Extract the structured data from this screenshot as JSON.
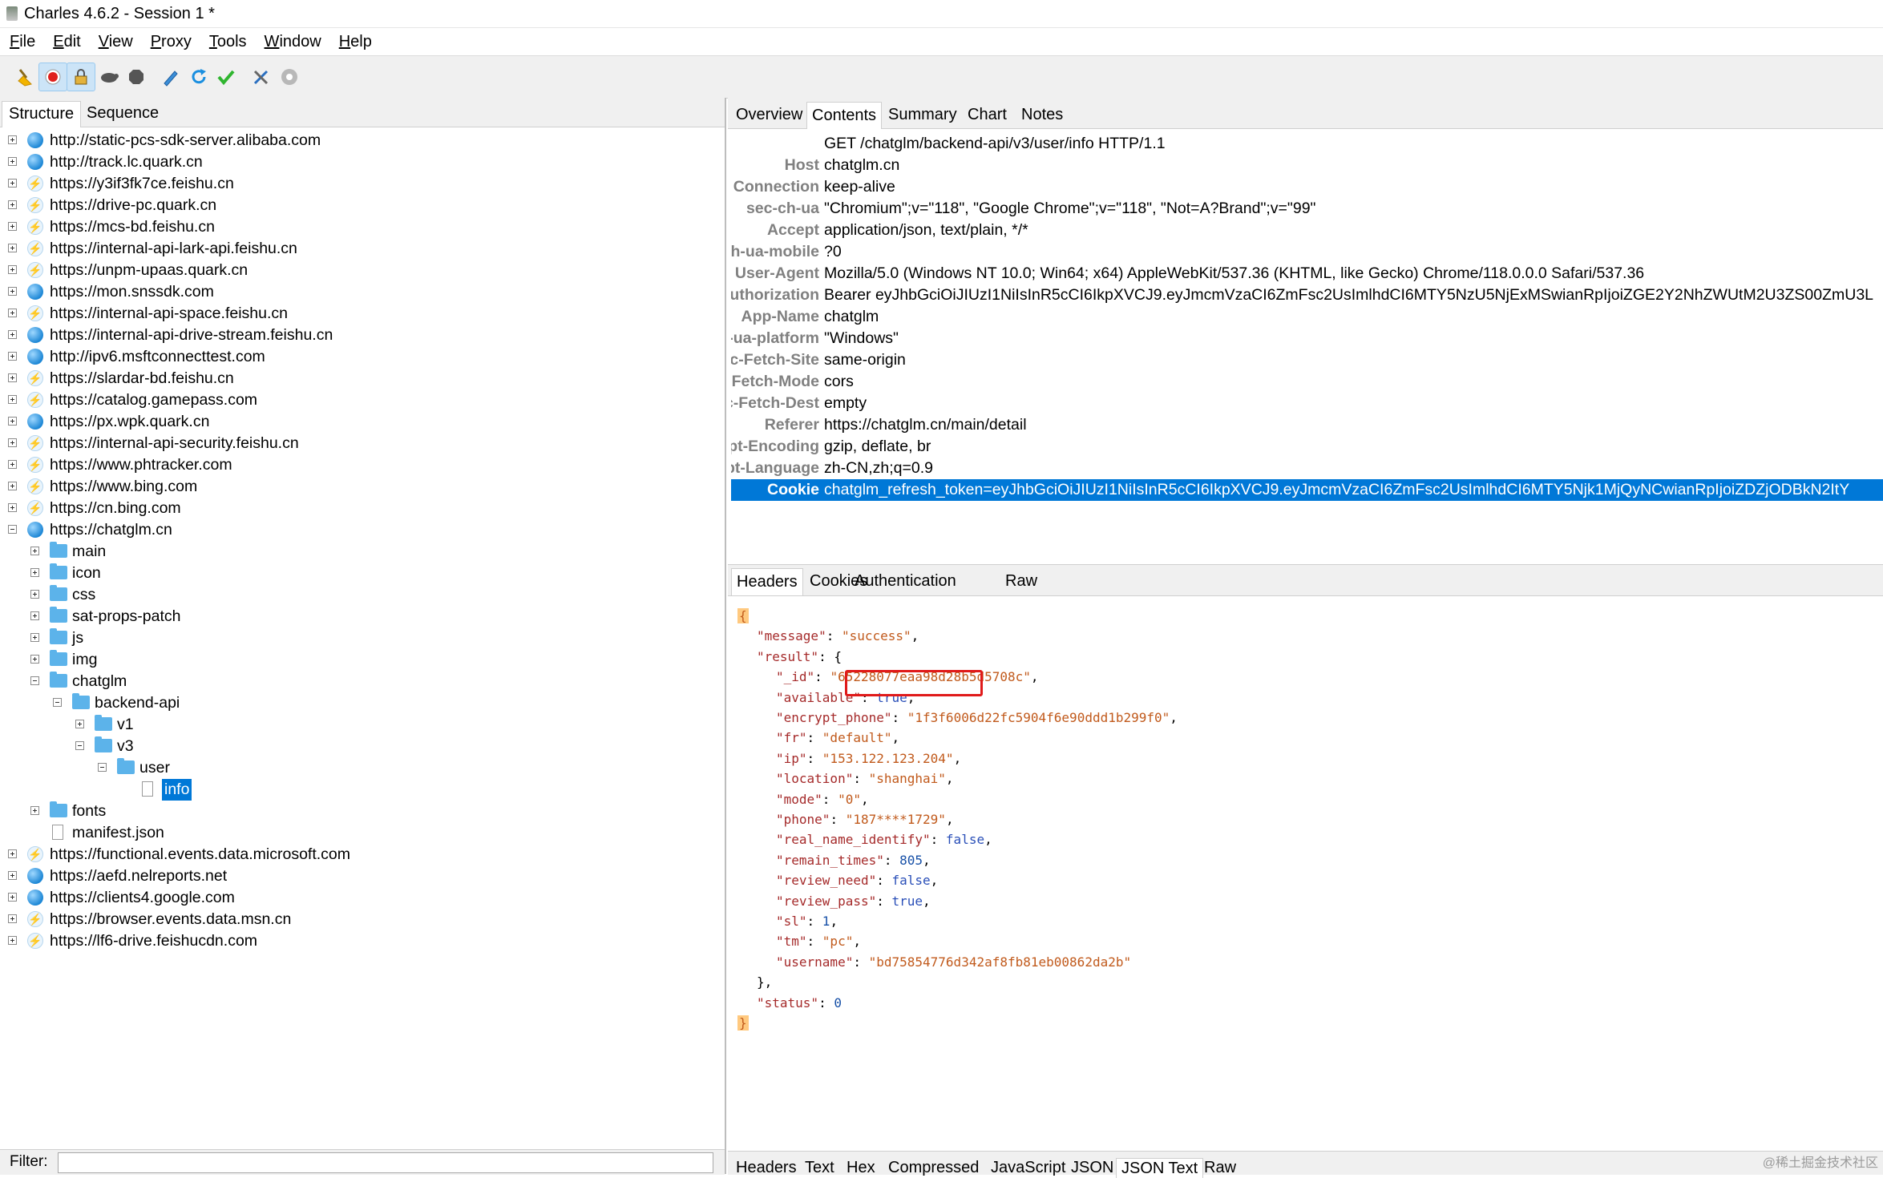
{
  "window": {
    "title": "Charles 4.6.2 - Session 1 *"
  },
  "menu": [
    "File",
    "Edit",
    "View",
    "Proxy",
    "Tools",
    "Window",
    "Help"
  ],
  "toolbar": {
    "buttons": [
      "broom-icon",
      "record-icon",
      "ssl-proxying-icon",
      "throttle-icon",
      "breakpoints-icon",
      "compose-icon",
      "repeat-icon",
      "validate-icon",
      "tools-icon",
      "settings-icon"
    ]
  },
  "left": {
    "tabs": [
      "Structure",
      "Sequence"
    ],
    "tree": [
      {
        "label": "http://static-pcs-sdk-server.alibaba.com",
        "icon": "globe",
        "depth": 0,
        "exp": "plus"
      },
      {
        "label": "http://track.lc.quark.cn",
        "icon": "globe",
        "depth": 0,
        "exp": "plus"
      },
      {
        "label": "https://y3if3fk7ce.feishu.cn",
        "icon": "bolt",
        "depth": 0,
        "exp": "plus"
      },
      {
        "label": "https://drive-pc.quark.cn",
        "icon": "bolt",
        "depth": 0,
        "exp": "plus"
      },
      {
        "label": "https://mcs-bd.feishu.cn",
        "icon": "bolt",
        "depth": 0,
        "exp": "plus"
      },
      {
        "label": "https://internal-api-lark-api.feishu.cn",
        "icon": "bolt",
        "depth": 0,
        "exp": "plus"
      },
      {
        "label": "https://unpm-upaas.quark.cn",
        "icon": "bolt",
        "depth": 0,
        "exp": "plus"
      },
      {
        "label": "https://mon.snssdk.com",
        "icon": "globe",
        "depth": 0,
        "exp": "plus"
      },
      {
        "label": "https://internal-api-space.feishu.cn",
        "icon": "bolt",
        "depth": 0,
        "exp": "plus"
      },
      {
        "label": "https://internal-api-drive-stream.feishu.cn",
        "icon": "globe",
        "depth": 0,
        "exp": "plus"
      },
      {
        "label": "http://ipv6.msftconnecttest.com",
        "icon": "globe",
        "depth": 0,
        "exp": "plus"
      },
      {
        "label": "https://slardar-bd.feishu.cn",
        "icon": "bolt",
        "depth": 0,
        "exp": "plus"
      },
      {
        "label": "https://catalog.gamepass.com",
        "icon": "bolt",
        "depth": 0,
        "exp": "plus"
      },
      {
        "label": "https://px.wpk.quark.cn",
        "icon": "globe",
        "depth": 0,
        "exp": "plus"
      },
      {
        "label": "https://internal-api-security.feishu.cn",
        "icon": "bolt",
        "depth": 0,
        "exp": "plus"
      },
      {
        "label": "https://www.phtracker.com",
        "icon": "bolt",
        "depth": 0,
        "exp": "plus"
      },
      {
        "label": "https://www.bing.com",
        "icon": "bolt",
        "depth": 0,
        "exp": "plus"
      },
      {
        "label": "https://cn.bing.com",
        "icon": "bolt",
        "depth": 0,
        "exp": "plus"
      },
      {
        "label": "https://chatglm.cn",
        "icon": "globe",
        "depth": 0,
        "exp": "minus"
      },
      {
        "label": "main",
        "icon": "folder",
        "depth": 1,
        "exp": "plus"
      },
      {
        "label": "icon",
        "icon": "folder",
        "depth": 1,
        "exp": "plus"
      },
      {
        "label": "css",
        "icon": "folder",
        "depth": 1,
        "exp": "plus"
      },
      {
        "label": "sat-props-patch",
        "icon": "folder",
        "depth": 1,
        "exp": "plus"
      },
      {
        "label": "js",
        "icon": "folder",
        "depth": 1,
        "exp": "plus"
      },
      {
        "label": "img",
        "icon": "folder",
        "depth": 1,
        "exp": "plus"
      },
      {
        "label": "chatglm",
        "icon": "folder",
        "depth": 1,
        "exp": "minus"
      },
      {
        "label": "backend-api",
        "icon": "folder",
        "depth": 2,
        "exp": "minus"
      },
      {
        "label": "v1",
        "icon": "folder",
        "depth": 3,
        "exp": "plus"
      },
      {
        "label": "v3",
        "icon": "folder",
        "depth": 3,
        "exp": "minus"
      },
      {
        "label": "user",
        "icon": "folder",
        "depth": 4,
        "exp": "minus"
      },
      {
        "label": "info",
        "icon": "file",
        "depth": 5,
        "exp": "none",
        "selected": true
      },
      {
        "label": "fonts",
        "icon": "folder",
        "depth": 1,
        "exp": "plus"
      },
      {
        "label": "manifest.json",
        "icon": "file",
        "depth": 1,
        "exp": "none"
      },
      {
        "label": "https://functional.events.data.microsoft.com",
        "icon": "bolt",
        "depth": 0,
        "exp": "plus"
      },
      {
        "label": "https://aefd.nelreports.net",
        "icon": "globe",
        "depth": 0,
        "exp": "plus"
      },
      {
        "label": "https://clients4.google.com",
        "icon": "globe",
        "depth": 0,
        "exp": "plus"
      },
      {
        "label": "https://browser.events.data.msn.cn",
        "icon": "bolt",
        "depth": 0,
        "exp": "plus"
      },
      {
        "label": "https://lf6-drive.feishucdn.com",
        "icon": "bolt",
        "depth": 0,
        "exp": "plus"
      }
    ],
    "filter_label": "Filter:"
  },
  "right": {
    "tabs": [
      "Overview",
      "Contents",
      "Summary",
      "Chart",
      "Notes"
    ],
    "active_tab": "Contents",
    "request_line": "GET /chatglm/backend-api/v3/user/info HTTP/1.1",
    "headers": [
      {
        "key": "Host",
        "value": "chatglm.cn"
      },
      {
        "key": "Connection",
        "value": "keep-alive"
      },
      {
        "key": "sec-ch-ua",
        "value": "\"Chromium\";v=\"118\", \"Google Chrome\";v=\"118\", \"Not=A?Brand\";v=\"99\""
      },
      {
        "key": "Accept",
        "value": "application/json, text/plain, */*"
      },
      {
        "key": "sec-ch-ua-mobile",
        "value": "?0"
      },
      {
        "key": "User-Agent",
        "value": "Mozilla/5.0 (Windows NT 10.0; Win64; x64) AppleWebKit/537.36 (KHTML, like Gecko) Chrome/118.0.0.0 Safari/537.36"
      },
      {
        "key": "Authorization",
        "value": "Bearer eyJhbGciOiJIUzI1NiIsInR5cCI6IkpXVCJ9.eyJmcmVzaCI6ZmFsc2UsImlhdCI6MTY5NzU5NjExMSwianRpIjoiZGE2Y2NhZWUtM2U3ZS00ZmU3L"
      },
      {
        "key": "App-Name",
        "value": "chatglm"
      },
      {
        "key": "sec-ch-ua-platform",
        "value": "\"Windows\""
      },
      {
        "key": "Sec-Fetch-Site",
        "value": "same-origin"
      },
      {
        "key": "Sec-Fetch-Mode",
        "value": "cors"
      },
      {
        "key": "Sec-Fetch-Dest",
        "value": "empty"
      },
      {
        "key": "Referer",
        "value": "https://chatglm.cn/main/detail"
      },
      {
        "key": "Accept-Encoding",
        "value": "gzip, deflate, br"
      },
      {
        "key": "Accept-Language",
        "value": "zh-CN,zh;q=0.9"
      },
      {
        "key": "Cookie",
        "value": "chatglm_refresh_token=eyJhbGciOiJIUzI1NiIsInR5cCI6IkpXVCJ9.eyJmcmVzaCI6ZmFsc2UsImlhdCI6MTY5Njk1MjQyNCwianRpIjoiZDZjODBkN2ItY",
        "selected": true
      }
    ],
    "request_tabs": [
      "Headers",
      "Cookies",
      "Authentication",
      "Raw"
    ],
    "response_tabs": [
      "Headers",
      "Text",
      "Hex",
      "Compressed",
      "JavaScript",
      "JSON",
      "JSON Text",
      "Raw"
    ],
    "response_active_tab": "JSON Text",
    "json": {
      "message": "success",
      "_id": "65228077eaa98d28b5d5708c",
      "available": "true",
      "encrypt_phone": "1f3f6006d22fc5904f6e90ddd1b299f0",
      "fr": "default",
      "ip": "153.122.123.204",
      "location": "shanghai",
      "mode": "0",
      "phone": "187****1729",
      "real_name_identify": "false",
      "remain_times": "805",
      "review_need": "false",
      "review_pass": "true",
      "sl": "1",
      "tm": "pc",
      "username": "bd75854776d342af8fb81eb00862da2b",
      "status": "0"
    }
  },
  "watermark": "@稀土掘金技术社区"
}
